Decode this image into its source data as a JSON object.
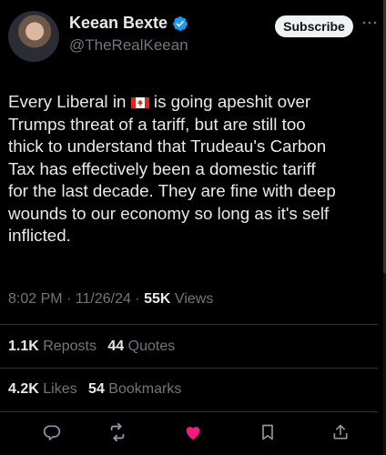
{
  "author": {
    "name": "Keean Bexte",
    "handle": "@TheRealKeean"
  },
  "header": {
    "subscribe_label": "Subscribe",
    "more_label": "···"
  },
  "tweet": {
    "text_before_flag": "Every Liberal in ",
    "flag_icon": "canada-flag-icon",
    "text_after_flag": " is going apeshit over\nTrumps threat of a tariff, but are still too\nthick to understand that Trudeau's Carbon\nTax has effectively been a domestic tariff\nfor the last decade. They are fine with deep\nwounds to our economy so long as it's self\ninflicted."
  },
  "meta": {
    "time": "8:02 PM",
    "sep1": " · ",
    "date": "11/26/24",
    "sep2": " · ",
    "views_count": "55K",
    "views_label": " Views"
  },
  "stats": {
    "reposts_count": "1.1K",
    "reposts_label": " Reposts",
    "quotes_count": "44",
    "quotes_label": " Quotes",
    "likes_count": "4.2K",
    "likes_label": " Likes",
    "bookmarks_count": "54",
    "bookmarks_label": " Bookmarks"
  },
  "actions": {
    "icons": [
      "reply-icon",
      "repost-icon",
      "like-icon-filled",
      "bookmark-icon",
      "share-icon"
    ]
  },
  "colors": {
    "background": "#000000",
    "text": "#e7e9ea",
    "muted": "#71767b",
    "verified": "#1d9bf0",
    "like": "#f91880",
    "divider": "#2f3336"
  }
}
